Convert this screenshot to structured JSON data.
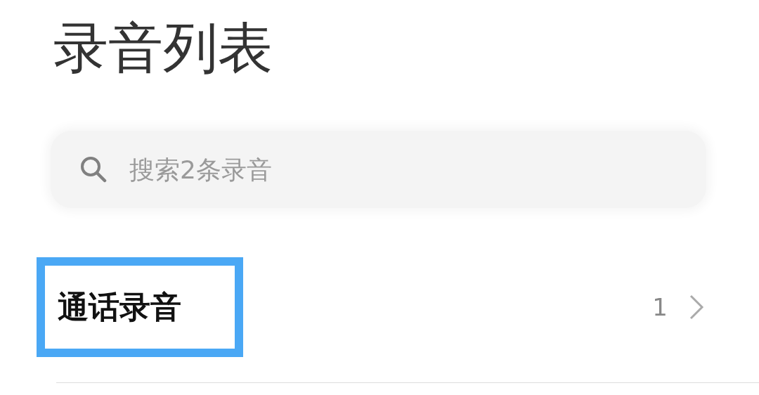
{
  "title": "录音列表",
  "search": {
    "placeholder": "搜索2条录音"
  },
  "folders": [
    {
      "name": "通话录音",
      "count": "1",
      "highlighted": true
    }
  ]
}
